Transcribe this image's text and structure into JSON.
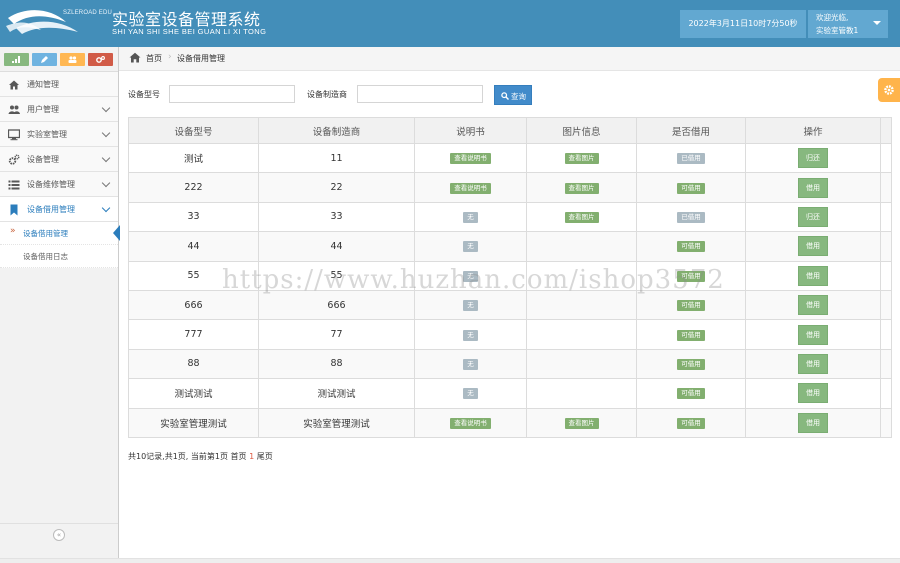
{
  "header": {
    "logo_text": "SZLEROAD EDU",
    "title": "实验室设备管理系统",
    "subtitle": "SHI YAN SHI SHE BEI GUAN LI XI TONG",
    "datetime": "2022年3月11日10时7分50秒",
    "welcome": "欢迎光临,",
    "username": "实验室管教1"
  },
  "shortcuts": [
    {
      "icon": "signal-icon",
      "color": "#87b87f"
    },
    {
      "icon": "pencil-icon",
      "color": "#6fb3e0"
    },
    {
      "icon": "users-icon",
      "color": "#ffb752"
    },
    {
      "icon": "cogs-icon",
      "color": "#d15b47"
    }
  ],
  "sidebar": {
    "items": [
      {
        "label": "通知管理",
        "icon": "home-icon"
      },
      {
        "label": "用户管理",
        "icon": "users-icon"
      },
      {
        "label": "实验室管理",
        "icon": "desktop-icon"
      },
      {
        "label": "设备管理",
        "icon": "cogs-icon"
      },
      {
        "label": "设备维修管理",
        "icon": "list-icon"
      },
      {
        "label": "设备借用管理",
        "icon": "bookmark-icon"
      }
    ],
    "sub_items": [
      {
        "label": "设备借用管理",
        "active": true
      },
      {
        "label": "设备借用日志",
        "active": false
      }
    ],
    "collapse_symbol": "«"
  },
  "breadcrumb": {
    "home": "首页",
    "separator": "›",
    "current": "设备借用管理"
  },
  "search": {
    "model_label": "设备型号",
    "model_value": "",
    "maker_label": "设备制造商",
    "maker_value": "",
    "button_label": "查询"
  },
  "table": {
    "headers": [
      "设备型号",
      "设备制造商",
      "说明书",
      "图片信息",
      "是否借用",
      "操作",
      ""
    ],
    "rows": [
      {
        "model": "测试",
        "maker": "11",
        "manual": "查看说明书",
        "manual_avail": true,
        "image": "查看图片",
        "status": "已借用",
        "borrowed": true,
        "action": "归还"
      },
      {
        "model": "222",
        "maker": "22",
        "manual": "查看说明书",
        "manual_avail": true,
        "image": "查看图片",
        "status": "可借用",
        "borrowed": false,
        "action": "借用"
      },
      {
        "model": "33",
        "maker": "33",
        "manual": "无",
        "manual_avail": false,
        "image": "查看图片",
        "status": "已借用",
        "borrowed": true,
        "action": "归还"
      },
      {
        "model": "44",
        "maker": "44",
        "manual": "无",
        "manual_avail": false,
        "image": "",
        "status": "可借用",
        "borrowed": false,
        "action": "借用"
      },
      {
        "model": "55",
        "maker": "55",
        "manual": "无",
        "manual_avail": false,
        "image": "",
        "status": "可借用",
        "borrowed": false,
        "action": "借用"
      },
      {
        "model": "666",
        "maker": "666",
        "manual": "无",
        "manual_avail": false,
        "image": "",
        "status": "可借用",
        "borrowed": false,
        "action": "借用"
      },
      {
        "model": "777",
        "maker": "77",
        "manual": "无",
        "manual_avail": false,
        "image": "",
        "status": "可借用",
        "borrowed": false,
        "action": "借用"
      },
      {
        "model": "88",
        "maker": "88",
        "manual": "无",
        "manual_avail": false,
        "image": "",
        "status": "可借用",
        "borrowed": false,
        "action": "借用"
      },
      {
        "model": "测试测试",
        "maker": "测试测试",
        "manual": "无",
        "manual_avail": false,
        "image": "",
        "status": "可借用",
        "borrowed": false,
        "action": "借用"
      },
      {
        "model": "实验室管理测试",
        "maker": "实验室管理测试",
        "manual": "查看说明书",
        "manual_avail": true,
        "image": "查看图片",
        "status": "可借用",
        "borrowed": false,
        "action": "借用"
      }
    ]
  },
  "pagination": {
    "prefix": "共10记录,共1页, 当前第1页 首页 ",
    "page": "1",
    "suffix": " 尾页"
  },
  "watermark": "https://www.huzhan.com/ishop3572"
}
